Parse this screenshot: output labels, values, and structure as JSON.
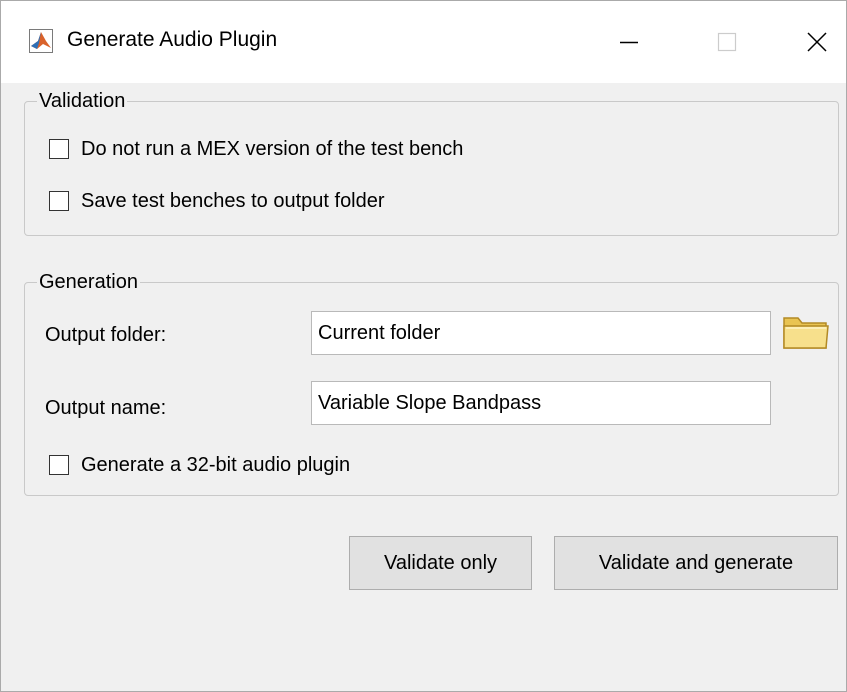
{
  "window": {
    "title": "Generate Audio Plugin",
    "icon": "matlab-icon",
    "controls": [
      "minimize-icon",
      "maximize-icon",
      "close-icon"
    ]
  },
  "validation": {
    "legend": "Validation",
    "options": [
      {
        "label": "Do not run a MEX version of the test bench",
        "checked": false
      },
      {
        "label": "Save test benches to output folder",
        "checked": false
      }
    ]
  },
  "generation": {
    "legend": "Generation",
    "output_folder_label": "Output folder:",
    "output_folder_value": "Current folder",
    "browse_icon": "folder-icon",
    "output_name_label": "Output name:",
    "output_name_value": "Variable Slope Bandpass",
    "plugin32": {
      "label": "Generate a 32-bit audio plugin",
      "checked": false
    }
  },
  "buttons": {
    "validate_only": "Validate only",
    "validate_and_generate": "Validate and generate"
  },
  "colors": {
    "window_bg": "#f0f0f0",
    "titlebar_bg": "#ffffff",
    "button_bg": "#e1e1e1",
    "folder_yellow": "#f3d56a"
  }
}
